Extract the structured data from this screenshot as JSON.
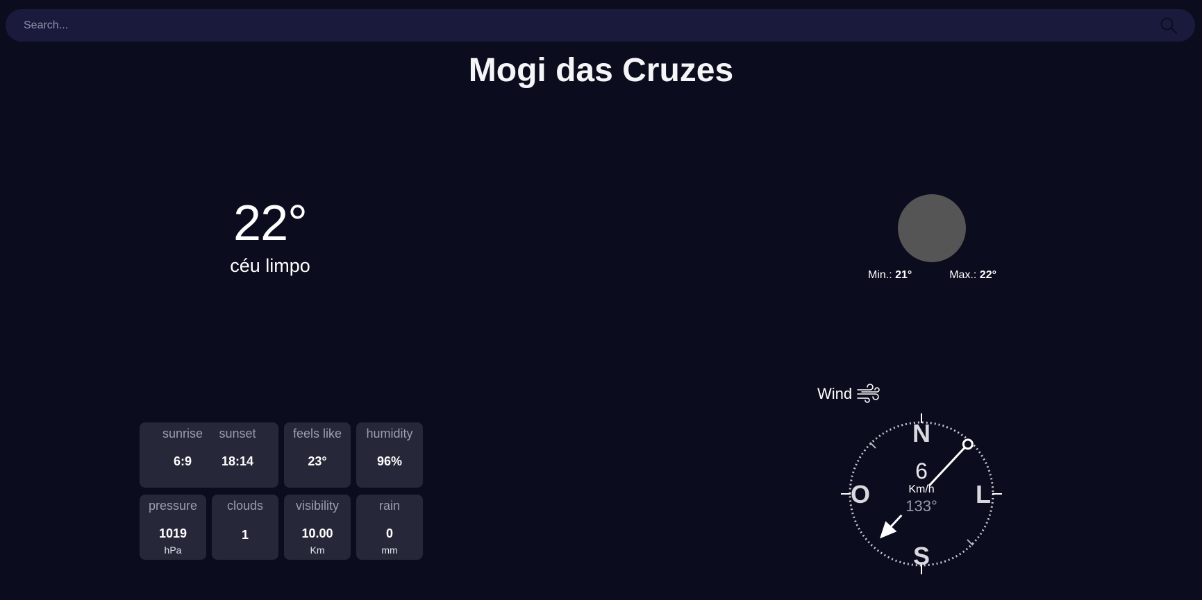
{
  "search": {
    "placeholder": "Search..."
  },
  "city": "Mogi das Cruzes",
  "current": {
    "temperature": "22°",
    "description": "céu limpo"
  },
  "minmax": {
    "min_label": "Min.:",
    "min_value": "21°",
    "max_label": "Max.:",
    "max_value": "22°"
  },
  "details": {
    "sunrise_label": "sunrise",
    "sunrise_value": "6:9",
    "sunset_label": "sunset",
    "sunset_value": "18:14",
    "feels_like_label": "feels like",
    "feels_like_value": "23°",
    "humidity_label": "humidity",
    "humidity_value": "96%",
    "pressure_label": "pressure",
    "pressure_value": "1019",
    "pressure_unit": "hPa",
    "clouds_label": "clouds",
    "clouds_value": "1",
    "visibility_label": "visibility",
    "visibility_value": "10.00",
    "visibility_unit": "Km",
    "rain_label": "rain",
    "rain_value": "0",
    "rain_unit": "mm"
  },
  "wind": {
    "title": "Wind",
    "speed": "6",
    "speed_unit": "Km/h",
    "direction": "133°",
    "direction_degrees": 133,
    "compass": {
      "n": "N",
      "e": "L",
      "s": "S",
      "w": "O"
    }
  },
  "icons": {
    "search": "search-icon",
    "wind": "wind-icon",
    "weather": "weather-icon-placeholder"
  },
  "colors": {
    "background": "#0b0c1e",
    "search_bg": "#1a1b3c",
    "card_bg": "#26283a",
    "icon_circle": "#555555"
  }
}
